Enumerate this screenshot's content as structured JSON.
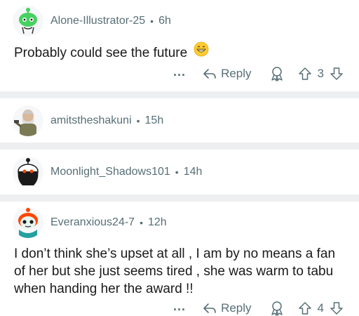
{
  "comments": [
    {
      "username": "Alone-Illustrator-25",
      "time": "6h",
      "body": "Probably could see the future",
      "emoji": "grinning-face-emoji",
      "reply_label": "Reply",
      "more_label": "...",
      "vote_count": "3"
    },
    {
      "username": "amitstheshakuni",
      "time": "15h"
    },
    {
      "username": "Moonlight_Shadows101",
      "time": "14h"
    },
    {
      "username": "Everanxious24-7",
      "time": "12h",
      "body": "I don’t think she’s upset at all , I am by no means a fan of her but she just seems tired , she was warm to tabu when handing her the award !!",
      "reply_label": "Reply",
      "more_label": "...",
      "vote_count": "4"
    }
  ],
  "separator": "•",
  "colors": {
    "meta_text": "#576f76",
    "separator": "#edeff1",
    "avatar_green": "#46d160",
    "avatar_orange": "#ff4500"
  },
  "icons": [
    "reply-arrow-icon",
    "award-icon",
    "upvote-icon",
    "downvote-icon",
    "more-options-icon"
  ]
}
